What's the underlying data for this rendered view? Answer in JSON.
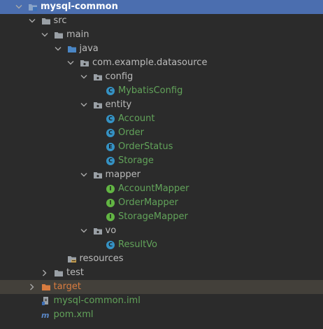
{
  "tree": {
    "rows": [
      {
        "label": "mysql-common",
        "depth": 0,
        "chevron": "down",
        "icon": "module-folder-icon",
        "style": "selected"
      },
      {
        "label": "src",
        "depth": 1,
        "chevron": "down",
        "icon": "folder-icon"
      },
      {
        "label": "main",
        "depth": 2,
        "chevron": "down",
        "icon": "folder-icon"
      },
      {
        "label": "java",
        "depth": 3,
        "chevron": "down",
        "icon": "source-folder-icon"
      },
      {
        "label": "com.example.datasource",
        "depth": 4,
        "chevron": "down",
        "icon": "package-icon"
      },
      {
        "label": "config",
        "depth": 5,
        "chevron": "down",
        "icon": "package-icon"
      },
      {
        "label": "MybatisConfig",
        "depth": 6,
        "chevron": "none",
        "icon": "class-icon",
        "badge": "C",
        "color": "green"
      },
      {
        "label": "entity",
        "depth": 5,
        "chevron": "down",
        "icon": "package-icon"
      },
      {
        "label": "Account",
        "depth": 6,
        "chevron": "none",
        "icon": "class-icon",
        "badge": "C",
        "color": "green"
      },
      {
        "label": "Order",
        "depth": 6,
        "chevron": "none",
        "icon": "class-icon",
        "badge": "C",
        "color": "green"
      },
      {
        "label": "OrderStatus",
        "depth": 6,
        "chevron": "none",
        "icon": "enum-icon",
        "badge": "E",
        "color": "green"
      },
      {
        "label": "Storage",
        "depth": 6,
        "chevron": "none",
        "icon": "class-icon",
        "badge": "C",
        "color": "green"
      },
      {
        "label": "mapper",
        "depth": 5,
        "chevron": "down",
        "icon": "package-icon"
      },
      {
        "label": "AccountMapper",
        "depth": 6,
        "chevron": "none",
        "icon": "interface-icon",
        "badge": "I",
        "color": "green"
      },
      {
        "label": "OrderMapper",
        "depth": 6,
        "chevron": "none",
        "icon": "interface-icon",
        "badge": "I",
        "color": "green"
      },
      {
        "label": "StorageMapper",
        "depth": 6,
        "chevron": "none",
        "icon": "interface-icon",
        "badge": "I",
        "color": "green"
      },
      {
        "label": "vo",
        "depth": 5,
        "chevron": "down",
        "icon": "package-icon"
      },
      {
        "label": "ResultVo",
        "depth": 6,
        "chevron": "none",
        "icon": "class-icon",
        "badge": "C",
        "color": "green"
      },
      {
        "label": "resources",
        "depth": 3,
        "chevron": "none",
        "icon": "resources-folder-icon"
      },
      {
        "label": "test",
        "depth": 2,
        "chevron": "right",
        "icon": "folder-icon"
      },
      {
        "label": "target",
        "depth": 1,
        "chevron": "right",
        "icon": "excluded-folder-icon",
        "style": "excluded",
        "color": "orange"
      },
      {
        "label": "mysql-common.iml",
        "depth": 1,
        "chevron": "none",
        "icon": "iml-file-icon",
        "color": "green"
      },
      {
        "label": "pom.xml",
        "depth": 1,
        "chevron": "none",
        "icon": "maven-icon",
        "color": "green"
      }
    ]
  },
  "colors": {
    "background": "#2b2b2b",
    "selection": "#4b6eaf",
    "excluded_row": "#43403a",
    "modified_text": "#62a35a",
    "excluded_text": "#d97c3f",
    "default_text": "#bbbbbb"
  }
}
